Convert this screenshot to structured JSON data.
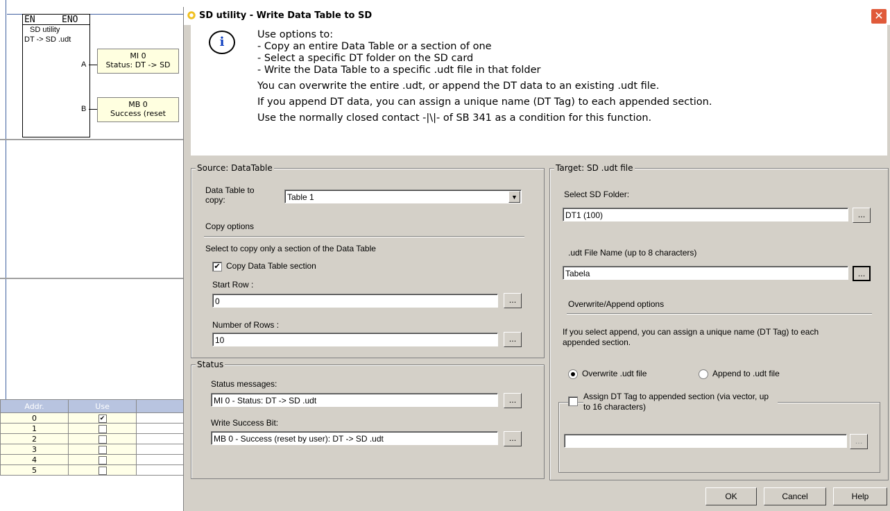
{
  "ladder": {
    "block": {
      "en": "EN",
      "eno": "ENO",
      "name": "SD utility",
      "func": "DT -> SD .udt",
      "pin_a": "A",
      "pin_b": "B"
    },
    "tag_a": {
      "line1": "MI 0",
      "line2": "Status: DT -> SD"
    },
    "tag_b": {
      "line1": "MB 0",
      "line2": "Success (reset"
    }
  },
  "addr_table": {
    "headers": [
      "Addr.",
      "Use"
    ],
    "rows": [
      {
        "addr": "0",
        "use": true
      },
      {
        "addr": "1",
        "use": false
      },
      {
        "addr": "2",
        "use": false
      },
      {
        "addr": "3",
        "use": false
      },
      {
        "addr": "4",
        "use": false
      },
      {
        "addr": "5",
        "use": false
      }
    ]
  },
  "dialog": {
    "title": "SD utility - Write Data Table to SD",
    "close": "✕",
    "info_lines": [
      "Use options to:",
      "- Copy an entire Data Table or a section of one",
      "- Select a specific DT folder on the SD card",
      "- Write the Data Table to a specific .udt file in that folder",
      "You can overwrite the entire .udt, or append the DT data to an existing .udt file.",
      "If you append DT data, you can assign a unique name (DT Tag) to each appended section.",
      "Use the normally closed contact -|\\|- of SB 341 as a condition for this function."
    ],
    "source": {
      "title": "Source: DataTable",
      "table_label": "Data Table to copy:",
      "table_value": "Table 1",
      "copy_options": "Copy options",
      "select_hint": "Select to copy only a section of the Data Table",
      "copy_section_label": "Copy Data Table section",
      "copy_section_checked": true,
      "start_row_label": "Start Row  :",
      "start_row_value": "0",
      "num_rows_label": "Number of Rows :",
      "num_rows_value": "10",
      "browse": "..."
    },
    "status": {
      "title": "Status",
      "messages_label": "Status messages:",
      "messages_value": "MI 0  - Status: DT -> SD .udt",
      "success_label": "Write Success Bit:",
      "success_value": "MB 0  - Success (reset by user): DT -> SD .udt"
    },
    "target": {
      "title": "Target: SD .udt file",
      "folder_label": "Select SD Folder:",
      "folder_value": "DT1 (100)",
      "file_label": ".udt File Name (up to 8 characters)",
      "file_value": "Tabela",
      "overwrite_options": "Overwrite/Append options",
      "append_hint": "If you select append, you can assign a unique name (DT Tag) to each appended section.",
      "overwrite_label": "Overwrite .udt file",
      "append_label": "Append to .udt file",
      "overwrite_selected": true,
      "dt_tag_label": "Assign DT Tag to appended section (via vector, up to 16 characters)",
      "dt_tag_value": ""
    },
    "buttons": {
      "ok": "OK",
      "cancel": "Cancel",
      "help": "Help"
    }
  }
}
